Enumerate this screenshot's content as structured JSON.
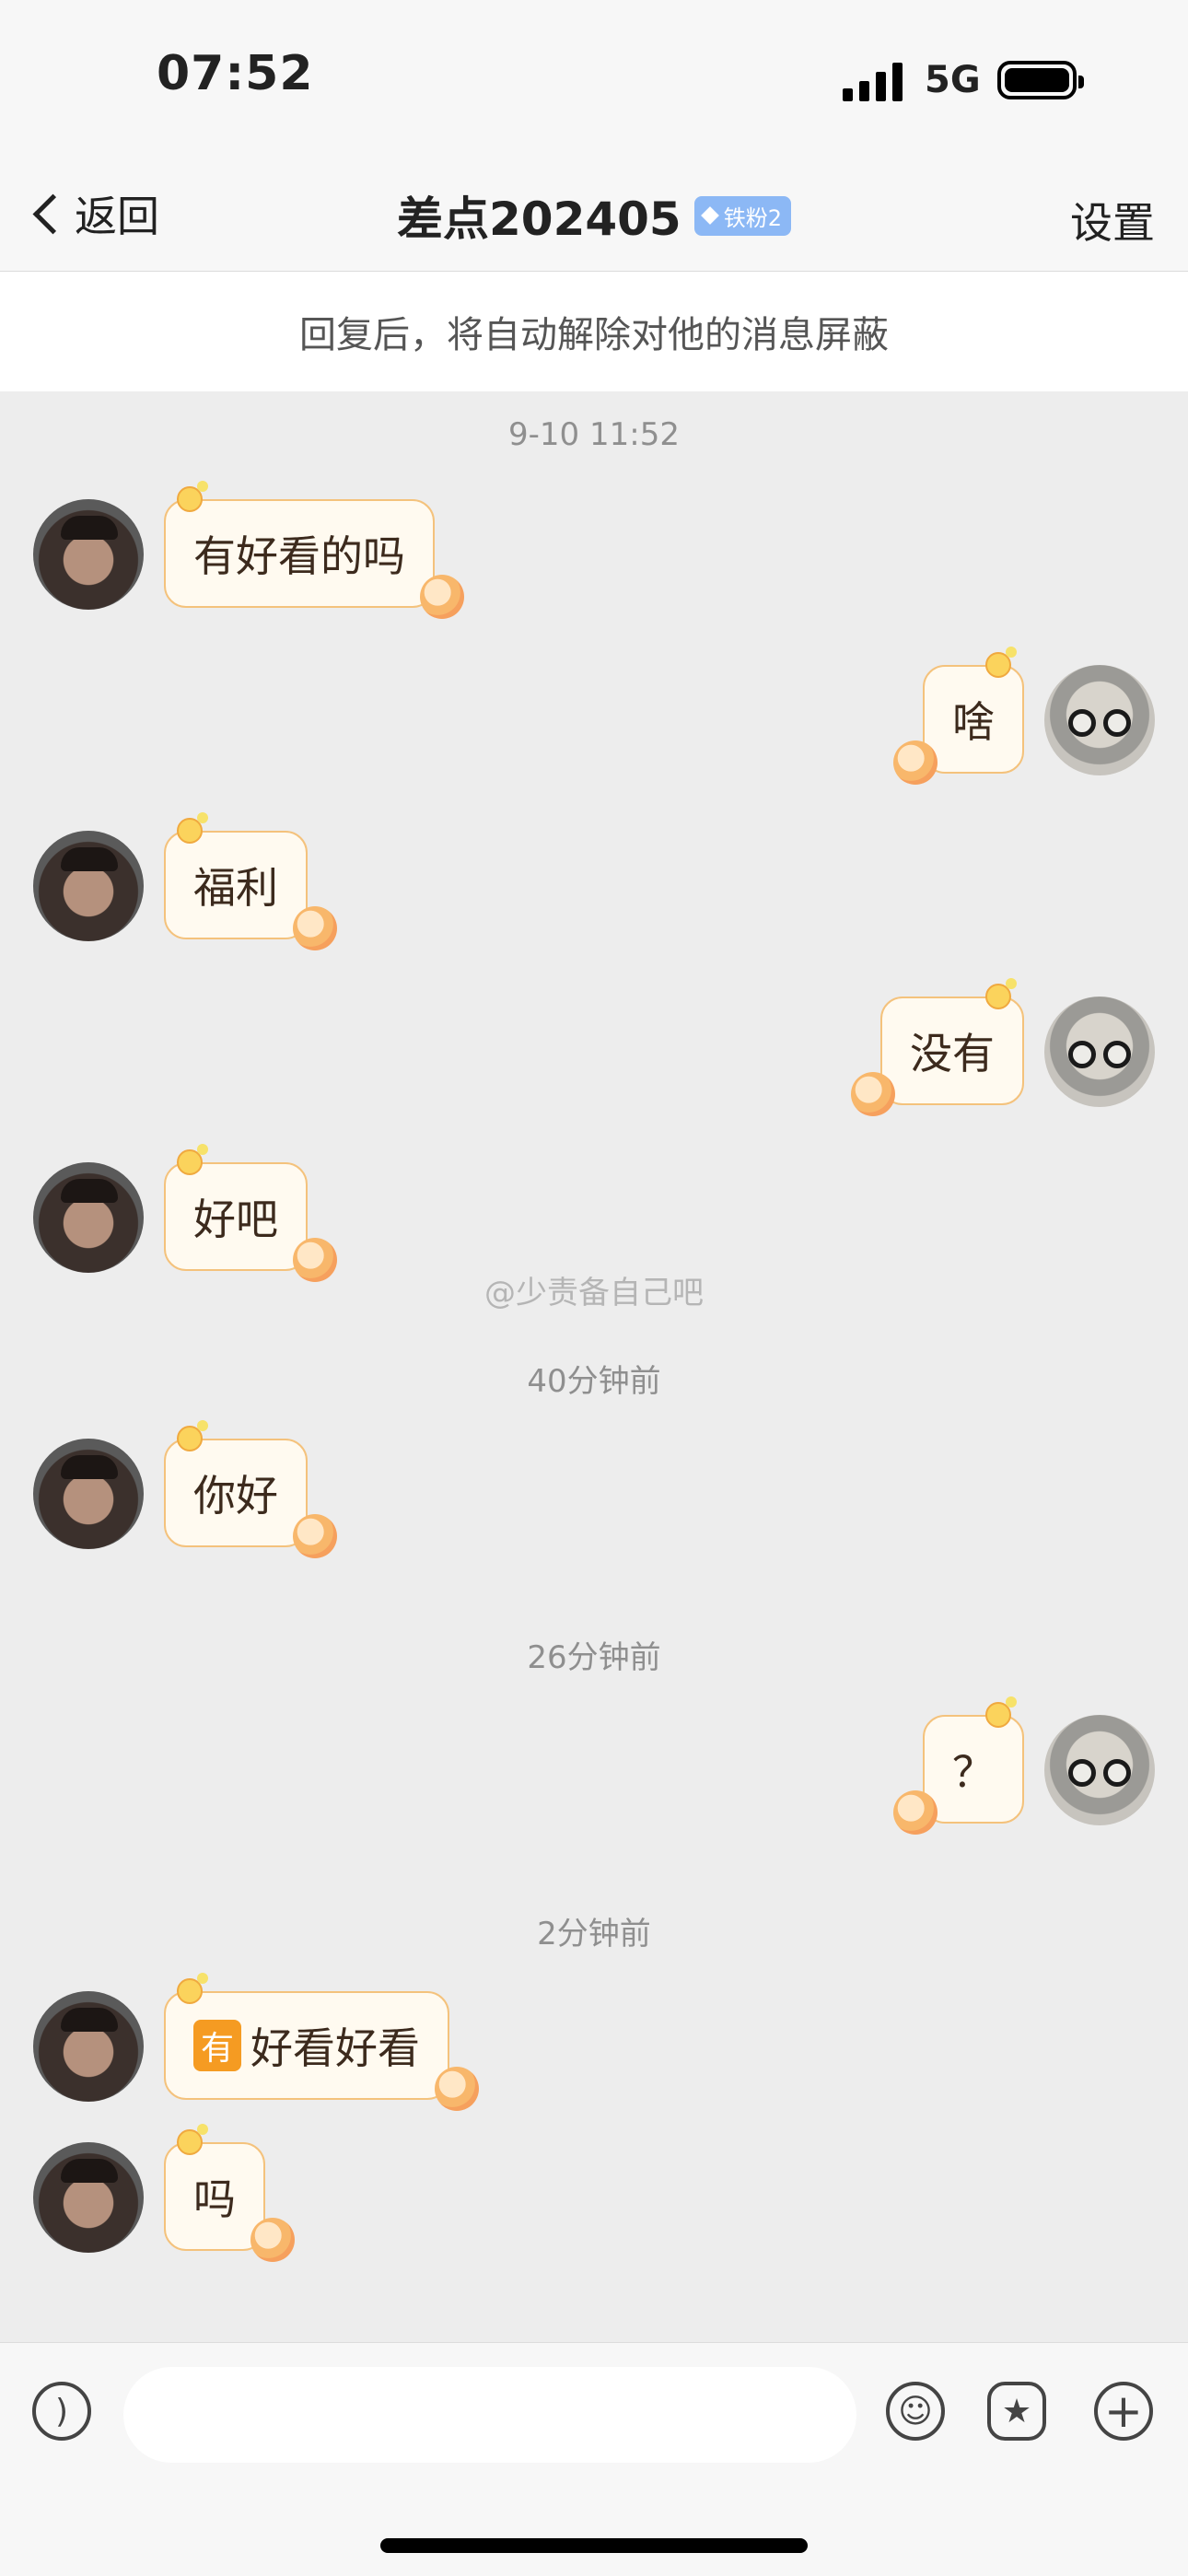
{
  "status_bar": {
    "time": "07:52",
    "network": "5G"
  },
  "nav": {
    "back_label": "返回",
    "title": "差点202405",
    "fan_badge": "铁粉2",
    "settings_label": "设置"
  },
  "notice": "回复后，将自动解除对他的消息屏蔽",
  "watermark": "@少责备自己吧",
  "timestamps": [
    "9-10 11:52",
    "40分钟前",
    "26分钟前",
    "2分钟前"
  ],
  "messages": [
    {
      "side": "in",
      "text": "有好看的吗"
    },
    {
      "side": "out",
      "text": "啥"
    },
    {
      "side": "in",
      "text": "福利"
    },
    {
      "side": "out",
      "text": "没有"
    },
    {
      "side": "in",
      "text": "好吧"
    },
    {
      "side": "in",
      "text": "你好"
    },
    {
      "side": "out",
      "text": "？"
    },
    {
      "side": "in",
      "tag": "有",
      "text": "好看好看"
    },
    {
      "side": "in",
      "text": "吗"
    }
  ],
  "input_bar": {
    "placeholder": ""
  },
  "icons": [
    "back-chevron-icon",
    "diamond-icon",
    "voice-icon",
    "emoji-icon",
    "sticker-icon",
    "plus-icon"
  ]
}
